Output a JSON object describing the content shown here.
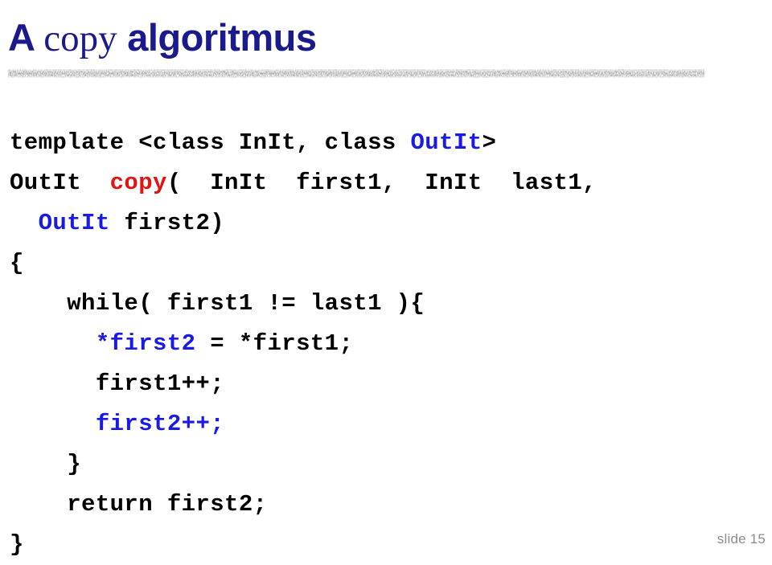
{
  "slide": {
    "title": {
      "part_plain_1": "A ",
      "part_code": "copy",
      "part_plain_2": " algoritmus",
      "color": "#1a1a8c"
    },
    "divider": {
      "name": "textured-horizontal-rule",
      "color": "#6e6e6e"
    },
    "code": {
      "language": "C++",
      "colors": {
        "default": "#000000",
        "type": "#1a1ae6",
        "function": "#e01414"
      },
      "lines": [
        {
          "id": "line-1",
          "tokens": [
            {
              "text": "template <class InIt, class ",
              "color": "black"
            },
            {
              "text": "OutIt",
              "color": "blue"
            },
            {
              "text": ">",
              "color": "black"
            }
          ]
        },
        {
          "id": "line-2",
          "tokens": [
            {
              "text": "OutIt  ",
              "color": "black"
            },
            {
              "text": "copy",
              "color": "red"
            },
            {
              "text": "(  InIt  first1,  InIt  last1,",
              "color": "black"
            }
          ]
        },
        {
          "id": "line-3",
          "tokens": [
            {
              "text": "  ",
              "color": "black"
            },
            {
              "text": "OutIt",
              "color": "blue"
            },
            {
              "text": " first2)",
              "color": "black"
            }
          ]
        },
        {
          "id": "line-4",
          "tokens": [
            {
              "text": "{",
              "color": "black"
            }
          ]
        },
        {
          "id": "line-5",
          "tokens": [
            {
              "text": "    while( first1 != last1 ){",
              "color": "black"
            }
          ]
        },
        {
          "id": "line-6",
          "tokens": [
            {
              "text": "      ",
              "color": "black"
            },
            {
              "text": "*first2",
              "color": "blue"
            },
            {
              "text": " = *first1;",
              "color": "black"
            }
          ]
        },
        {
          "id": "line-7",
          "tokens": [
            {
              "text": "      first1++;",
              "color": "black"
            }
          ]
        },
        {
          "id": "line-8",
          "tokens": [
            {
              "text": "      ",
              "color": "black"
            },
            {
              "text": "first2++;",
              "color": "blue"
            }
          ]
        },
        {
          "id": "line-9",
          "tokens": [
            {
              "text": "    }",
              "color": "black"
            }
          ]
        },
        {
          "id": "line-10",
          "tokens": [
            {
              "text": "    return first2;",
              "color": "black"
            }
          ]
        },
        {
          "id": "line-11",
          "tokens": [
            {
              "text": "}",
              "color": "black"
            }
          ]
        }
      ]
    },
    "footer": {
      "slide_number_label": "slide 15",
      "color": "#8c8c8c"
    }
  }
}
